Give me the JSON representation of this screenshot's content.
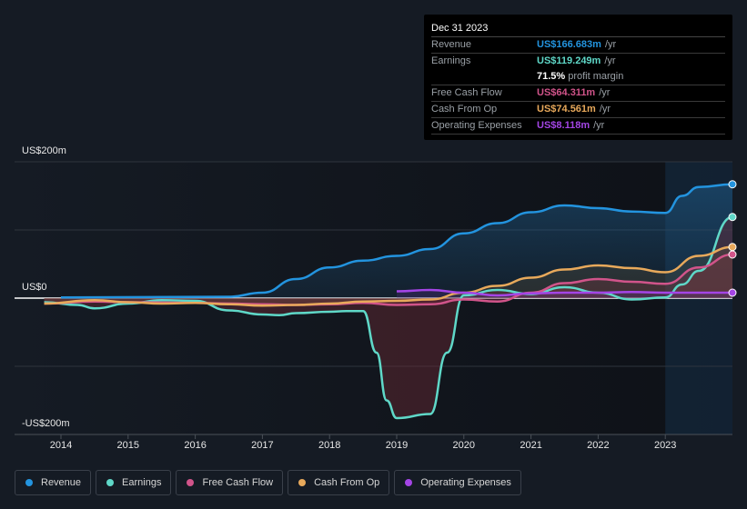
{
  "chart_data": {
    "type": "line",
    "title": "",
    "xlabel": "",
    "ylabel": "",
    "ylim": [
      -200,
      200
    ],
    "xlim": [
      2013.75,
      2024.0
    ],
    "y_tick_labels": [
      "US$200m",
      "US$0",
      "-US$200m"
    ],
    "y_ticks": [
      200,
      0,
      -200
    ],
    "x_tick_labels": [
      "2014",
      "2015",
      "2016",
      "2017",
      "2018",
      "2019",
      "2020",
      "2021",
      "2022",
      "2023"
    ],
    "x_ticks": [
      2014,
      2015,
      2016,
      2017,
      2018,
      2019,
      2020,
      2021,
      2022,
      2023
    ],
    "grid": true,
    "forecast_shade_from": 2023.0,
    "legend_position": "bottom",
    "series": [
      {
        "name": "Revenue",
        "color": "#2394df",
        "x": [
          2014.0,
          2016.5,
          2017.0,
          2017.5,
          2018.0,
          2018.5,
          2019.0,
          2019.5,
          2020.0,
          2020.5,
          2021.0,
          2021.5,
          2022.0,
          2022.5,
          2023.0,
          2023.25,
          2023.5,
          2024.0
        ],
        "y": [
          1,
          2,
          8,
          28,
          45,
          55,
          62,
          72,
          95,
          110,
          126,
          136,
          132,
          127,
          125,
          150,
          163,
          167
        ]
      },
      {
        "name": "Earnings",
        "color": "#5fd8c8",
        "x": [
          2013.75,
          2014.25,
          2014.5,
          2015.0,
          2015.5,
          2016.0,
          2016.5,
          2017.0,
          2017.25,
          2017.5,
          2018.0,
          2018.25,
          2018.5,
          2018.7,
          2018.85,
          2019.0,
          2019.5,
          2019.75,
          2020.0,
          2020.5,
          2021.0,
          2021.5,
          2022.0,
          2022.5,
          2023.0,
          2023.25,
          2023.5,
          2024.0
        ],
        "y": [
          -6,
          -10,
          -15,
          -8,
          -3,
          -4,
          -18,
          -24,
          -25,
          -22,
          -20,
          -19,
          -19,
          -80,
          -150,
          -176,
          -170,
          -80,
          4,
          12,
          6,
          16,
          8,
          -2,
          1,
          20,
          40,
          119
        ]
      },
      {
        "name": "Free Cash Flow",
        "color": "#d1548a",
        "x": [
          2013.75,
          2014.5,
          2015.0,
          2016.0,
          2016.5,
          2017.0,
          2017.5,
          2018.0,
          2018.5,
          2019.0,
          2019.5,
          2020.0,
          2020.5,
          2021.0,
          2021.5,
          2022.0,
          2022.5,
          2023.0,
          2023.5,
          2024.0
        ],
        "y": [
          -8,
          -5,
          -6,
          -7,
          -8,
          -9,
          -10,
          -9,
          -7,
          -10,
          -9,
          -2,
          -5,
          8,
          22,
          28,
          24,
          21,
          45,
          64
        ]
      },
      {
        "name": "Cash From Op",
        "color": "#e8a95b",
        "x": [
          2013.75,
          2014.5,
          2015.0,
          2015.5,
          2016.0,
          2016.5,
          2017.0,
          2017.5,
          2018.0,
          2018.5,
          2019.0,
          2019.5,
          2020.0,
          2020.5,
          2021.0,
          2021.5,
          2022.0,
          2022.5,
          2023.0,
          2023.5,
          2024.0
        ],
        "y": [
          -8,
          -3,
          -6,
          -8,
          -7,
          -9,
          -11,
          -10,
          -8,
          -5,
          -4,
          -2,
          8,
          18,
          30,
          42,
          48,
          44,
          38,
          62,
          75
        ]
      },
      {
        "name": "Operating Expenses",
        "color": "#a445e6",
        "x": [
          2019.0,
          2019.5,
          2020.0,
          2020.5,
          2021.0,
          2021.5,
          2022.0,
          2022.5,
          2023.0,
          2023.5,
          2024.0
        ],
        "y": [
          10,
          12,
          8,
          4,
          7,
          8,
          8,
          9,
          8,
          8,
          8
        ]
      }
    ]
  },
  "tooltip": {
    "date": "Dec 31 2023",
    "rows": [
      {
        "label": "Revenue",
        "value": "US$166.683m",
        "unit": "/yr",
        "color": "#2394df"
      },
      {
        "label": "Earnings",
        "value": "US$119.249m",
        "unit": "/yr",
        "color": "#5fd8c8"
      },
      {
        "label": "",
        "value": "71.5%",
        "unit": "profit margin",
        "color": "#ffffff"
      },
      {
        "label": "Free Cash Flow",
        "value": "US$64.311m",
        "unit": "/yr",
        "color": "#d1548a"
      },
      {
        "label": "Cash From Op",
        "value": "US$74.561m",
        "unit": "/yr",
        "color": "#e8a95b"
      },
      {
        "label": "Operating Expenses",
        "value": "US$8.118m",
        "unit": "/yr",
        "color": "#a445e6"
      }
    ]
  },
  "legend": [
    {
      "label": "Revenue",
      "color": "#2394df"
    },
    {
      "label": "Earnings",
      "color": "#5fd8c8"
    },
    {
      "label": "Free Cash Flow",
      "color": "#d1548a"
    },
    {
      "label": "Cash From Op",
      "color": "#e8a95b"
    },
    {
      "label": "Operating Expenses",
      "color": "#a445e6"
    }
  ]
}
